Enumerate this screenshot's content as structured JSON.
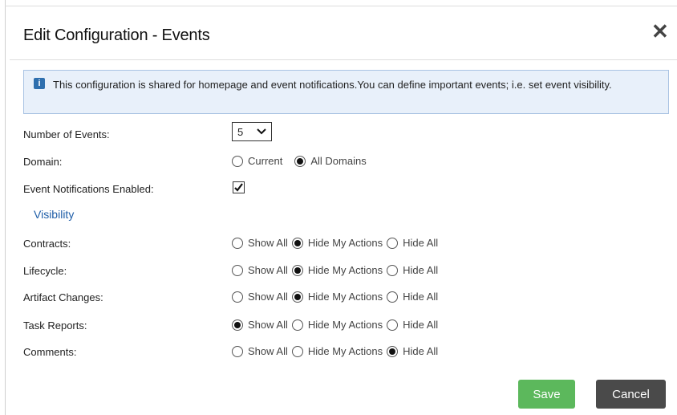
{
  "dialog": {
    "title": "Edit Configuration - Events",
    "close_glyph": "✕",
    "info_icon": "i",
    "info_text": "This configuration is shared for homepage and event notifications.You can define important events; i.e. set event visibility."
  },
  "fields": {
    "number_of_events": {
      "label": "Number of Events:",
      "value": "5"
    },
    "domain": {
      "label": "Domain:",
      "options": [
        "Current",
        "All Domains"
      ],
      "selected": "All Domains"
    },
    "notifications": {
      "label": "Event Notifications Enabled:",
      "checked": true
    }
  },
  "visibility": {
    "heading": "Visibility",
    "options": [
      "Show All",
      "Hide My Actions",
      "Hide All"
    ],
    "rows": [
      {
        "label": "Contracts:",
        "selected": "Hide My Actions"
      },
      {
        "label": "Lifecycle:",
        "selected": "Hide My Actions"
      },
      {
        "label": "Artifact Changes:",
        "selected": "Hide My Actions"
      },
      {
        "label": "Task Reports:",
        "selected": "Show All"
      },
      {
        "label": "Comments:",
        "selected": "Hide All"
      }
    ]
  },
  "buttons": {
    "save": "Save",
    "cancel": "Cancel"
  },
  "colors": {
    "save": "#5cb85c",
    "cancel": "#4a4a4a",
    "info_bg": "#e8f0fa",
    "link": "#1f5ea8"
  }
}
